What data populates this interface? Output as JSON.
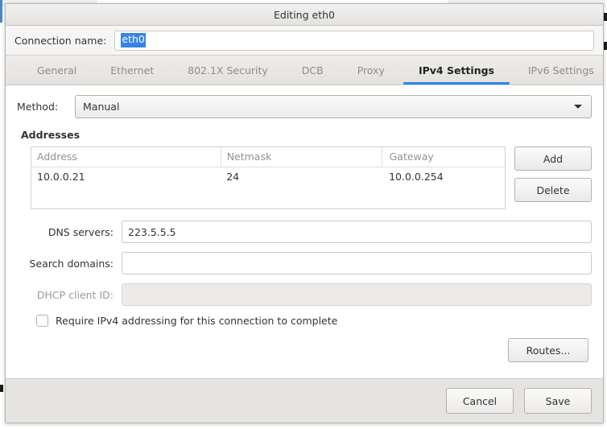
{
  "window": {
    "title": "Editing eth0"
  },
  "connection_name": {
    "label": "Connection name:",
    "value": "eth0",
    "selected": true,
    "selection_color": "#3584e4"
  },
  "tabs": [
    {
      "label": "General",
      "active": false
    },
    {
      "label": "Ethernet",
      "active": false
    },
    {
      "label": "802.1X Security",
      "active": false
    },
    {
      "label": "DCB",
      "active": false
    },
    {
      "label": "Proxy",
      "active": false
    },
    {
      "label": "IPv4 Settings",
      "active": true
    },
    {
      "label": "IPv6 Settings",
      "active": false
    }
  ],
  "tab_accent_color": "#3584e4",
  "method": {
    "label": "Method:",
    "value": "Manual",
    "arrow_icon": "chevron-down-icon"
  },
  "addresses": {
    "section_title": "Addresses",
    "columns": [
      "Address",
      "Netmask",
      "Gateway"
    ],
    "rows": [
      {
        "address": "10.0.0.21",
        "netmask": "24",
        "gateway": "10.0.0.254"
      }
    ],
    "add_label": "Add",
    "delete_label": "Delete"
  },
  "dns_servers": {
    "label": "DNS servers:",
    "value": "223.5.5.5",
    "placeholder": ""
  },
  "search_domains": {
    "label": "Search domains:",
    "value": "",
    "placeholder": ""
  },
  "dhcp_client_id": {
    "label": "DHCP client ID:",
    "value": "",
    "placeholder": "",
    "disabled": true
  },
  "require_ipv4": {
    "label": "Require IPv4 addressing for this connection to complete",
    "checked": false
  },
  "routes": {
    "label": "Routes..."
  },
  "footer": {
    "cancel_label": "Cancel",
    "save_label": "Save"
  }
}
